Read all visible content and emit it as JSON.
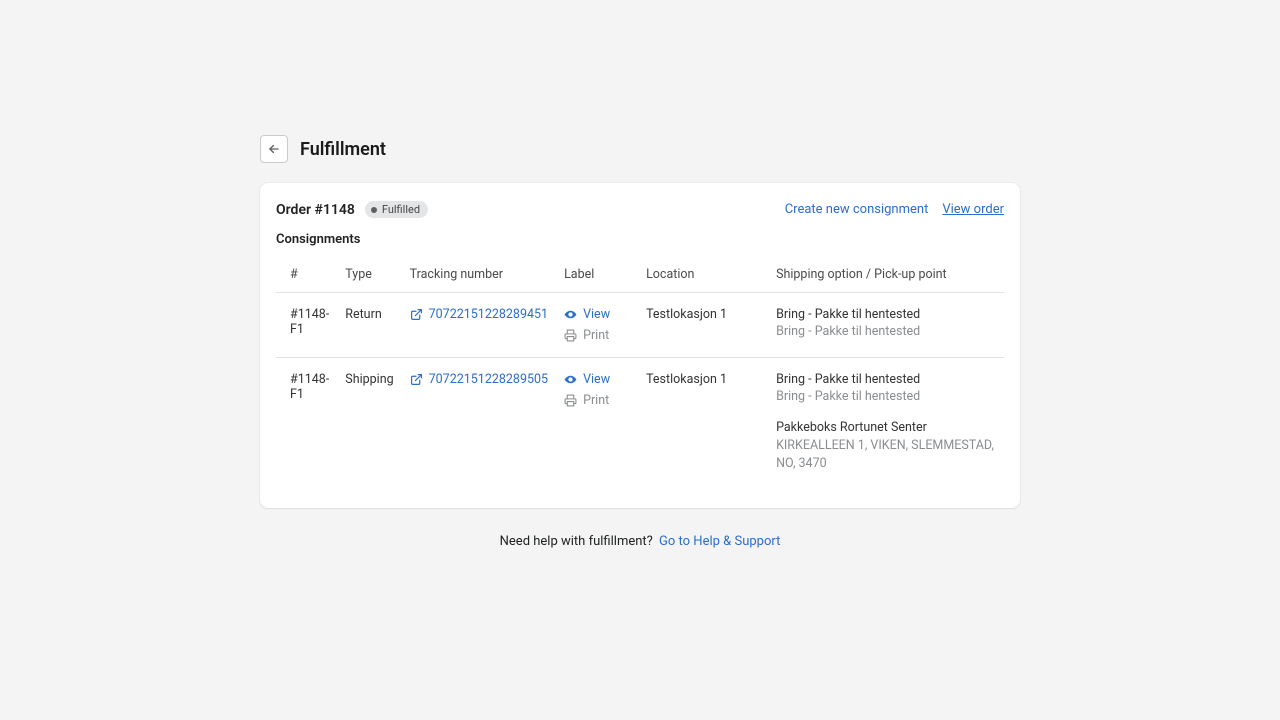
{
  "header": {
    "title": "Fulfillment"
  },
  "order": {
    "title": "Order #1148",
    "badge": "Fulfilled"
  },
  "actions": {
    "create": "Create new consignment",
    "view_order": "View order"
  },
  "section": {
    "consignments_title": "Consignments"
  },
  "columns": {
    "id": "#",
    "type": "Type",
    "tracking": "Tracking number",
    "label": "Label",
    "location": "Location",
    "shipping": "Shipping option / Pick-up point"
  },
  "labels": {
    "view": "View",
    "print": "Print"
  },
  "rows": [
    {
      "id": "#1148-F1",
      "type": "Return",
      "tracking": "70722151228289451",
      "location": "Testlokasjon 1",
      "shipping_main": "Bring - Pakke til hentested",
      "shipping_sub": "Bring - Pakke til hentested",
      "pickup_name": "",
      "pickup_addr": ""
    },
    {
      "id": "#1148-F1",
      "type": "Shipping",
      "tracking": "70722151228289505",
      "location": "Testlokasjon 1",
      "shipping_main": "Bring - Pakke til hentested",
      "shipping_sub": "Bring - Pakke til hentested",
      "pickup_name": "Pakkeboks Rortunet Senter",
      "pickup_addr": "KIRKEALLEEN 1, VIKEN, SLEMMESTAD, NO, 3470"
    }
  ],
  "footer": {
    "prefix": "Need help with fulfillment?",
    "link": "Go to Help & Support"
  }
}
